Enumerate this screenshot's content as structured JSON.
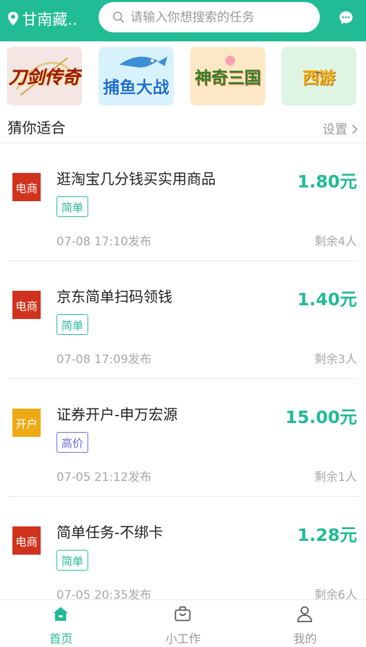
{
  "header": {
    "location": "甘南藏..",
    "search_placeholder": "请输入你想搜索的任务",
    "accent_color": "#21bb95"
  },
  "games": [
    {
      "name": "刀剑传奇",
      "icon": "game-banner-1"
    },
    {
      "name": "捕鱼大战",
      "icon": "game-banner-2"
    },
    {
      "name": "神奇三国",
      "icon": "game-banner-3"
    },
    {
      "name": "西游",
      "icon": "game-banner-4"
    }
  ],
  "section": {
    "title": "猜你适合",
    "setting_label": "设置"
  },
  "tasks": [
    {
      "category": "电商",
      "category_color": "#d0321e",
      "title": "逛淘宝几分钱买实用商品",
      "tag": "简单",
      "tag_color": "#21bb95",
      "price": "1.80元",
      "time": "07-08 17:10发布",
      "remaining": "剩余4人"
    },
    {
      "category": "电商",
      "category_color": "#d0321e",
      "title": "京东简单扫码领钱",
      "tag": "简单",
      "tag_color": "#21bb95",
      "price": "1.40元",
      "time": "07-08 17:09发布",
      "remaining": "剩余3人"
    },
    {
      "category": "开户",
      "category_color": "#eeaa14",
      "title": "证券开户-申万宏源",
      "tag": "高价",
      "tag_color": "#6a6ad8",
      "price": "15.00元",
      "time": "07-05 21:12发布",
      "remaining": "剩余1人"
    },
    {
      "category": "电商",
      "category_color": "#d0321e",
      "title": "简单任务-不绑卡",
      "tag": "简单",
      "tag_color": "#21bb95",
      "price": "1.28元",
      "time": "07-05 20:35发布",
      "remaining": "剩余6人"
    }
  ],
  "tabbar": [
    {
      "label": "首页",
      "icon": "home-icon",
      "active": true
    },
    {
      "label": "小工作",
      "icon": "briefcase-icon",
      "active": false
    },
    {
      "label": "我的",
      "icon": "user-icon",
      "active": false
    }
  ]
}
